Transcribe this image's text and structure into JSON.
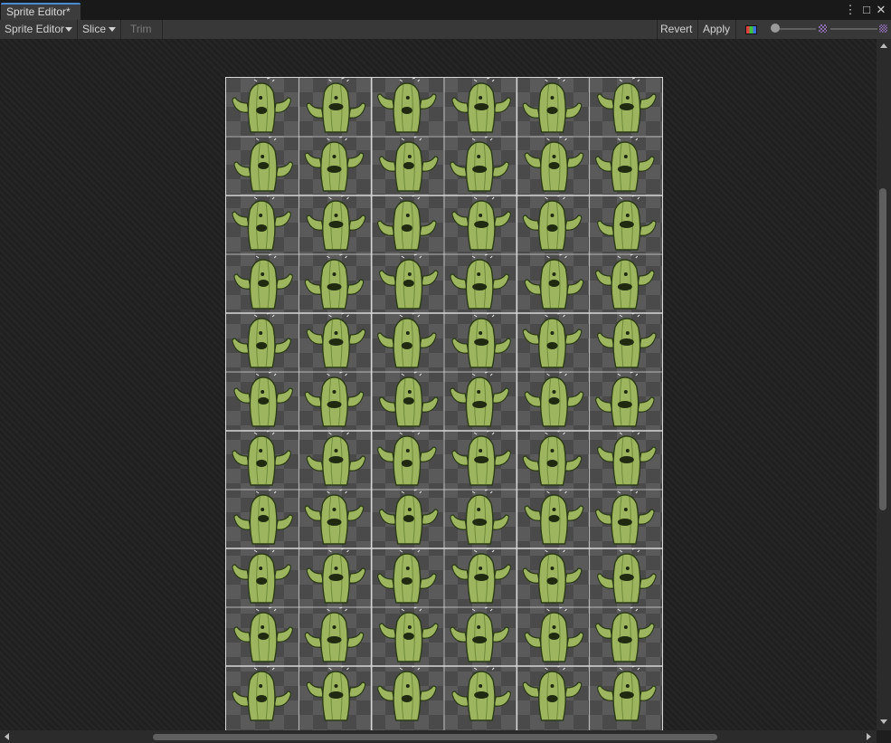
{
  "window": {
    "tab_title": "Sprite Editor*",
    "menu_icon": "kebab-menu-icon",
    "maximize_icon": "maximize-icon",
    "close_icon": "close-icon"
  },
  "toolbar": {
    "mode_label": "Sprite Editor",
    "slice_label": "Slice",
    "trim_label": "Trim",
    "revert_label": "Revert",
    "apply_label": "Apply",
    "color_channel_icon": "rgb-channels-icon",
    "zoom_icon": "zoom-slider-icon",
    "mip_icon": "mip-level-icon"
  },
  "sprite_sheet": {
    "columns": 6,
    "rows": 11,
    "sprite": "cactus-sprite",
    "colors": {
      "body": "#9cb55e",
      "body_dark": "#6f8a3a",
      "outline": "#2b3a16",
      "mustache": "#1f2a10",
      "checker_light": "#5a5a5a",
      "checker_dark": "#4a4a4a",
      "slice_line": "#d8d8d8"
    }
  }
}
